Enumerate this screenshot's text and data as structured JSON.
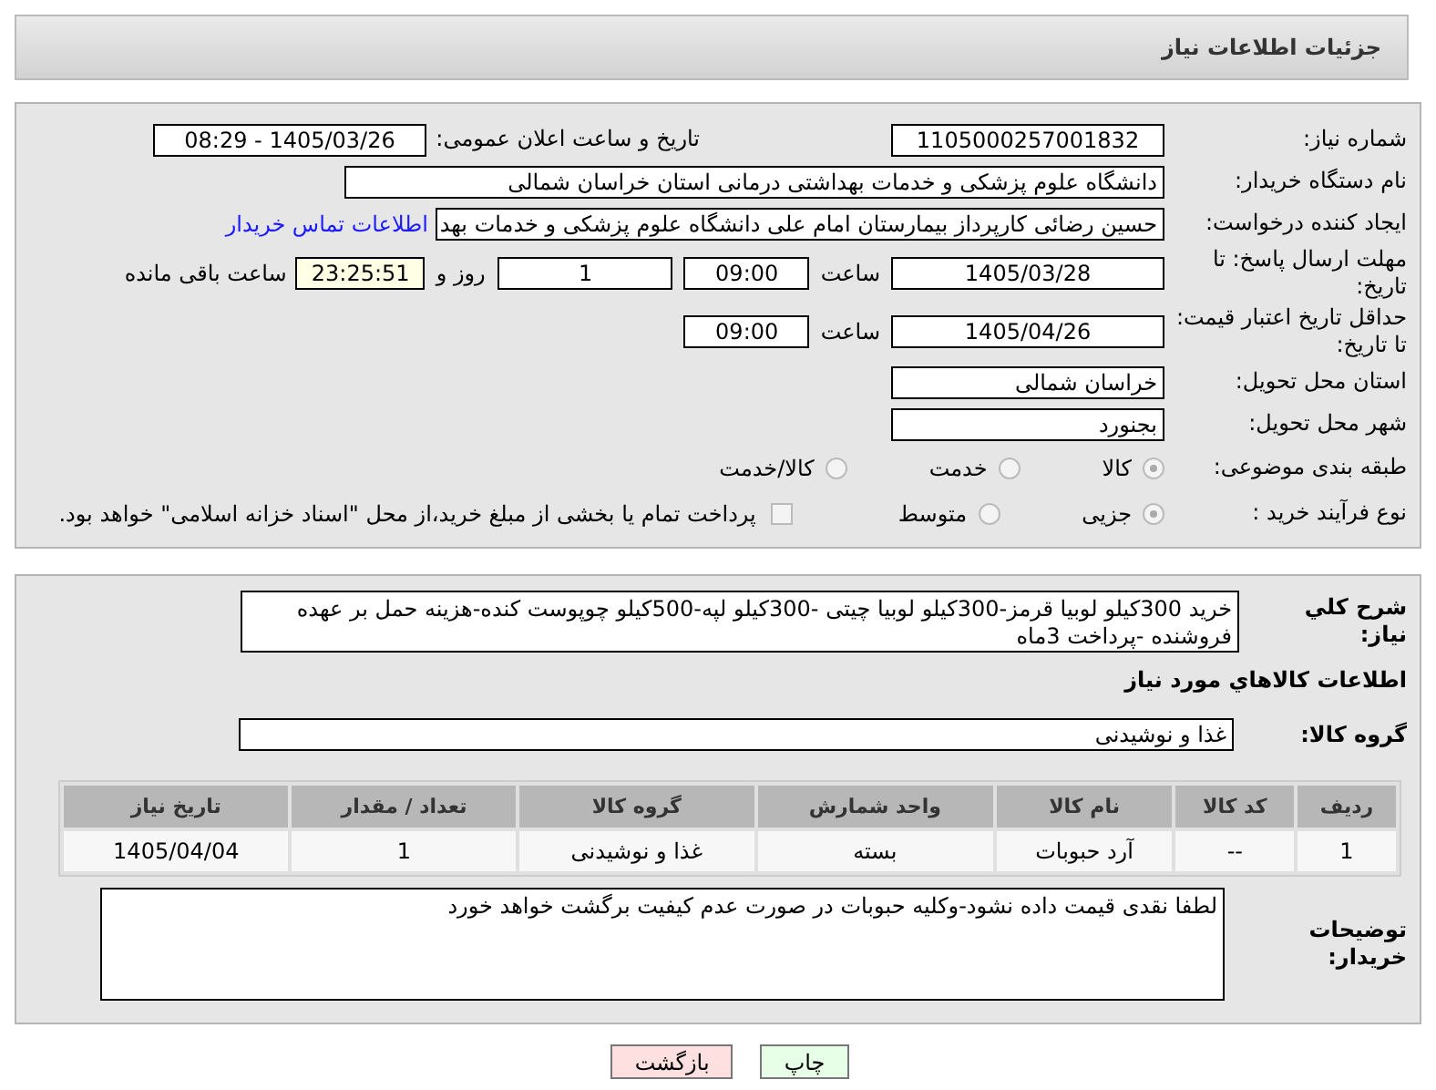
{
  "title": "جزئیات اطلاعات نیاز",
  "need_number": {
    "label": "شماره نیاز:",
    "value": "1105000257001832"
  },
  "announce": {
    "label": "تاریخ و ساعت اعلان عمومی:",
    "value": "1405/03/26 - 08:29"
  },
  "buyer_org": {
    "label": "نام دستگاه خریدار:",
    "value": "دانشگاه علوم پزشکی و خدمات بهداشتی درمانی استان خراسان شمالی"
  },
  "creator": {
    "label": "ایجاد کننده درخواست:",
    "value": "حسین رضائی کارپرداز بیمارستان امام علی دانشگاه علوم پزشکی و خدمات بهد",
    "link": "اطلاعات تماس خریدار"
  },
  "deadline": {
    "label": "مهلت ارسال پاسخ: تا تاریخ:",
    "date": "1405/03/28",
    "time_label": "ساعت",
    "time": "09:00",
    "days": "1",
    "days_label": "روز و",
    "remaining": "23:25:51",
    "remaining_label": "ساعت باقی مانده"
  },
  "price_validity": {
    "label": "حداقل تاریخ اعتبار قیمت: تا تاریخ:",
    "date": "1405/04/26",
    "time_label": "ساعت",
    "time": "09:00"
  },
  "province": {
    "label": "استان محل تحویل:",
    "value": "خراسان شمالی"
  },
  "city": {
    "label": "شهر محل تحویل:",
    "value": "بجنورد"
  },
  "category": {
    "label": "طبقه بندی موضوعی:",
    "options": [
      {
        "label": "کالا",
        "selected": true
      },
      {
        "label": "خدمت",
        "selected": false
      },
      {
        "label": "کالا/خدمت",
        "selected": false
      }
    ]
  },
  "process": {
    "label": "نوع فرآیند خرید :",
    "options": [
      {
        "label": "جزیی",
        "selected": true
      },
      {
        "label": "متوسط",
        "selected": false
      }
    ],
    "payment": {
      "checked": false,
      "text": "پرداخت تمام یا بخشی از مبلغ خرید،از محل \"اسناد خزانه اسلامی\" خواهد بود."
    }
  },
  "description": {
    "label": "شرح کلي نياز:",
    "value": "خرید 300کیلو لوبیا قرمز-300کیلو لوبیا چیتی -300کیلو لپه-500کیلو چوپوست کنده-هزینه حمل بر عهده فروشنده -پرداخت 3ماه"
  },
  "goods_heading": "اطلاعات کالاهاي مورد نياز",
  "group": {
    "label": "گروه کالا:",
    "value": "غذا و نوشیدنی"
  },
  "table": {
    "columns": [
      "ردیف",
      "کد کالا",
      "نام کالا",
      "واحد شمارش",
      "گروه کالا",
      "تعداد / مقدار",
      "تاریخ نیاز"
    ],
    "rows": [
      [
        "1",
        "--",
        "آرد حبوبات",
        "بسته",
        "غذا و نوشیدنی",
        "1",
        "1405/04/04"
      ]
    ]
  },
  "buyer_notes": {
    "label": "توضیحات خریدار:",
    "value": "لطفا نقدی قیمت داده نشود-وکلیه حبوبات در صورت عدم کیفیت برگشت خواهد خورد"
  },
  "buttons": [
    {
      "label": "چاپ",
      "kind": "print"
    },
    {
      "label": "بازگشت",
      "kind": "back"
    }
  ]
}
